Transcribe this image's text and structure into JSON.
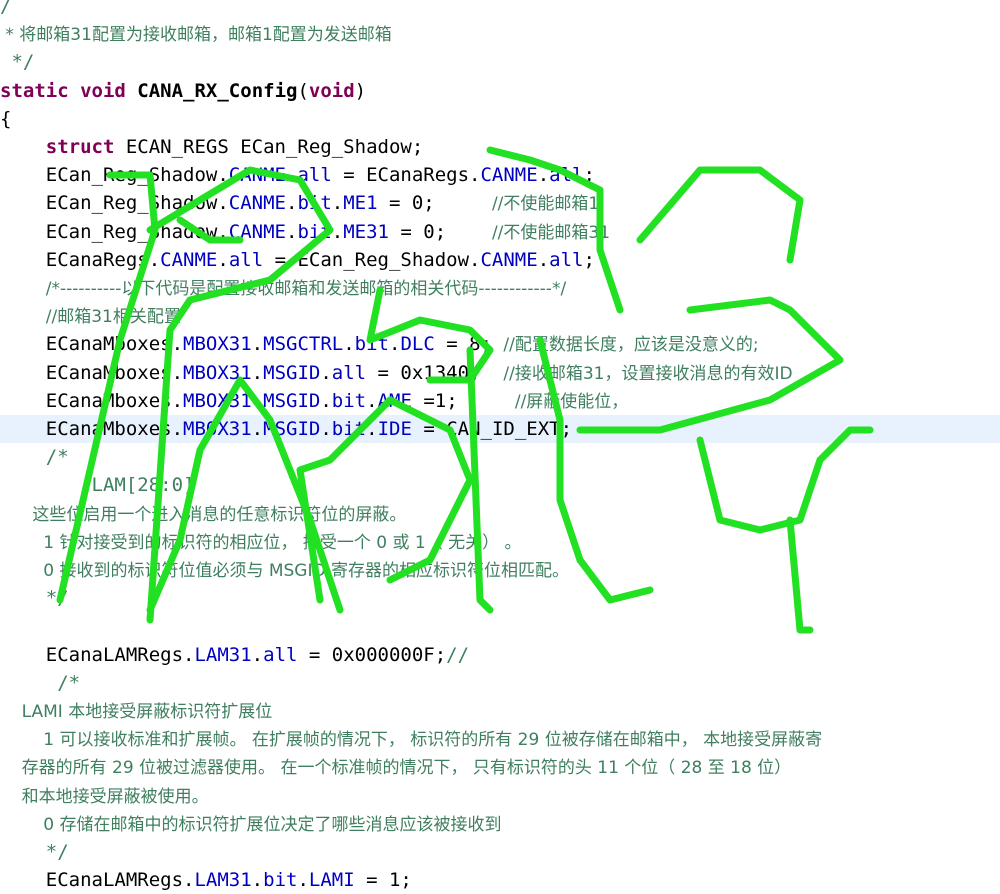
{
  "editor": {
    "highlight_color": "#e8f2fe",
    "colors": {
      "keyword": "#7f0055",
      "field": "#0000c0",
      "comment": "#3f7f5f",
      "watermark": "#22e022"
    },
    "lines": [
      [
        {
          "t": "c",
          "s": "/"
        }
      ],
      [
        {
          "t": "c",
          "s": " * 将邮箱31配置为接收邮箱，邮箱1配置为发送邮箱"
        }
      ],
      [
        {
          "t": "c",
          "s": " */"
        }
      ],
      [
        {
          "t": "k",
          "s": "static"
        },
        {
          "t": "n",
          "s": " "
        },
        {
          "t": "k",
          "s": "void"
        },
        {
          "t": "b",
          "s": " CANA_RX_Config"
        },
        {
          "t": "n",
          "s": "("
        },
        {
          "t": "k",
          "s": "void"
        },
        {
          "t": "n",
          "s": ")"
        }
      ],
      [
        {
          "t": "n",
          "s": "{"
        }
      ],
      [
        {
          "t": "n",
          "s": "    "
        },
        {
          "t": "k",
          "s": "struct"
        },
        {
          "t": "n",
          "s": " ECAN_REGS ECan_Reg_Shadow;"
        }
      ],
      [
        {
          "t": "n",
          "s": "    ECan_Reg_Shadow."
        },
        {
          "t": "f",
          "s": "CANME"
        },
        {
          "t": "n",
          "s": "."
        },
        {
          "t": "f",
          "s": "all"
        },
        {
          "t": "n",
          "s": " = ECanaRegs."
        },
        {
          "t": "f",
          "s": "CANME"
        },
        {
          "t": "n",
          "s": "."
        },
        {
          "t": "f",
          "s": "all"
        },
        {
          "t": "n",
          "s": ";"
        }
      ],
      [
        {
          "t": "n",
          "s": "    ECan_Reg_Shadow."
        },
        {
          "t": "f",
          "s": "CANME"
        },
        {
          "t": "n",
          "s": "."
        },
        {
          "t": "f",
          "s": "bit"
        },
        {
          "t": "n",
          "s": "."
        },
        {
          "t": "f",
          "s": "ME1"
        },
        {
          "t": "n",
          "s": " = 0;     "
        },
        {
          "t": "c",
          "s": "//不使能邮箱1"
        }
      ],
      [
        {
          "t": "n",
          "s": "    ECan_Reg_Shadow."
        },
        {
          "t": "f",
          "s": "CANME"
        },
        {
          "t": "n",
          "s": "."
        },
        {
          "t": "f",
          "s": "bit"
        },
        {
          "t": "n",
          "s": "."
        },
        {
          "t": "f",
          "s": "ME31"
        },
        {
          "t": "n",
          "s": " = 0;    "
        },
        {
          "t": "c",
          "s": "//不使能邮箱31"
        }
      ],
      [
        {
          "t": "n",
          "s": "    ECanaRegs."
        },
        {
          "t": "f",
          "s": "CANME"
        },
        {
          "t": "n",
          "s": "."
        },
        {
          "t": "f",
          "s": "all"
        },
        {
          "t": "n",
          "s": " = ECan_Reg_Shadow."
        },
        {
          "t": "f",
          "s": "CANME"
        },
        {
          "t": "n",
          "s": "."
        },
        {
          "t": "f",
          "s": "all"
        },
        {
          "t": "n",
          "s": ";"
        }
      ],
      [
        {
          "t": "n",
          "s": "    "
        },
        {
          "t": "c",
          "s": "/*----------以下代码是配置接收邮箱和发送邮箱的相关代码------------*/"
        }
      ],
      [
        {
          "t": "n",
          "s": "    "
        },
        {
          "t": "c",
          "s": "//邮箱31相关配置"
        }
      ],
      [
        {
          "t": "n",
          "s": "    ECanaMboxes."
        },
        {
          "t": "f",
          "s": "MBOX31"
        },
        {
          "t": "n",
          "s": "."
        },
        {
          "t": "f",
          "s": "MSGCTRL"
        },
        {
          "t": "n",
          "s": "."
        },
        {
          "t": "f",
          "s": "bit"
        },
        {
          "t": "n",
          "s": "."
        },
        {
          "t": "f",
          "s": "DLC"
        },
        {
          "t": "n",
          "s": " = 8; "
        },
        {
          "t": "c",
          "s": "//配置数据长度，应该是没意义的;"
        }
      ],
      [
        {
          "t": "n",
          "s": "    ECanaMboxes."
        },
        {
          "t": "f",
          "s": "MBOX31"
        },
        {
          "t": "n",
          "s": "."
        },
        {
          "t": "f",
          "s": "MSGID"
        },
        {
          "t": "n",
          "s": "."
        },
        {
          "t": "f",
          "s": "all"
        },
        {
          "t": "n",
          "s": " = 0x1340;  "
        },
        {
          "t": "c",
          "s": "//接收邮箱31，设置接收消息的有效ID"
        }
      ],
      [
        {
          "t": "n",
          "s": "    ECanaMboxes."
        },
        {
          "t": "f",
          "s": "MBOX31"
        },
        {
          "t": "n",
          "s": "."
        },
        {
          "t": "f",
          "s": "MSGID"
        },
        {
          "t": "n",
          "s": "."
        },
        {
          "t": "f",
          "s": "bit"
        },
        {
          "t": "n",
          "s": "."
        },
        {
          "t": "f",
          "s": "AME"
        },
        {
          "t": "n",
          "s": " =1;     "
        },
        {
          "t": "c",
          "s": "//屏蔽使能位，"
        }
      ],
      [
        {
          "t": "n",
          "s": "    ECanaMboxes."
        },
        {
          "t": "f",
          "s": "MBOX31"
        },
        {
          "t": "n",
          "s": "."
        },
        {
          "t": "f",
          "s": "MSGID"
        },
        {
          "t": "n",
          "s": "."
        },
        {
          "t": "f",
          "s": "bit"
        },
        {
          "t": "n",
          "s": "."
        },
        {
          "t": "f",
          "s": "IDE"
        },
        {
          "t": "n",
          "s": " = CAN_ID_EXT;"
        }
      ],
      [
        {
          "t": "n",
          "s": "    "
        },
        {
          "t": "c",
          "s": "/*"
        }
      ],
      [
        {
          "t": "c",
          "s": "        LAM[28:0]"
        }
      ],
      [
        {
          "t": "c",
          "s": "      这些位启用一个进入消息的任意标识符位的屏蔽。"
        }
      ],
      [
        {
          "t": "c",
          "s": "        1 针对接受到的标识符的相应位， 接受一个 0 或 1（ 无关） 。"
        }
      ],
      [
        {
          "t": "c",
          "s": "        0 接收到的标识符位值必须与 MSGID 寄存器的相应标识符位相匹配。"
        }
      ],
      [
        {
          "t": "c",
          "s": "    */"
        }
      ],
      [
        {
          "t": "n",
          "s": ""
        }
      ],
      [
        {
          "t": "n",
          "s": "    ECanaLAMRegs."
        },
        {
          "t": "f",
          "s": "LAM31"
        },
        {
          "t": "n",
          "s": "."
        },
        {
          "t": "f",
          "s": "all"
        },
        {
          "t": "n",
          "s": " = 0x000000F;"
        },
        {
          "t": "c",
          "s": "//"
        }
      ],
      [
        {
          "t": "c",
          "s": "     /*"
        }
      ],
      [
        {
          "t": "c",
          "s": "    LAMI 本地接受屏蔽标识符扩展位"
        }
      ],
      [
        {
          "t": "c",
          "s": "        1 可以接收标准和扩展帧。 在扩展帧的情况下， 标识符的所有 29 位被存储在邮箱中， 本地接受屏蔽寄"
        }
      ],
      [
        {
          "t": "c",
          "s": "    存器的所有 29 位被过滤器使用。 在一个标准帧的情况下， 只有标识符的头 11 个位（ 28 至 18 位）"
        }
      ],
      [
        {
          "t": "c",
          "s": "    和本地接受屏蔽被使用。"
        }
      ],
      [
        {
          "t": "c",
          "s": "        0 存储在邮箱中的标识符扩展位决定了哪些消息应该被接收到"
        }
      ],
      [
        {
          "t": "c",
          "s": "    */"
        }
      ],
      [
        {
          "t": "n",
          "s": "    ECanaLAMRegs."
        },
        {
          "t": "f",
          "s": "LAM31"
        },
        {
          "t": "n",
          "s": "."
        },
        {
          "t": "f",
          "s": "bit"
        },
        {
          "t": "n",
          "s": "."
        },
        {
          "t": "f",
          "s": "LAMI"
        },
        {
          "t": "n",
          "s": " = 1;"
        }
      ]
    ]
  }
}
